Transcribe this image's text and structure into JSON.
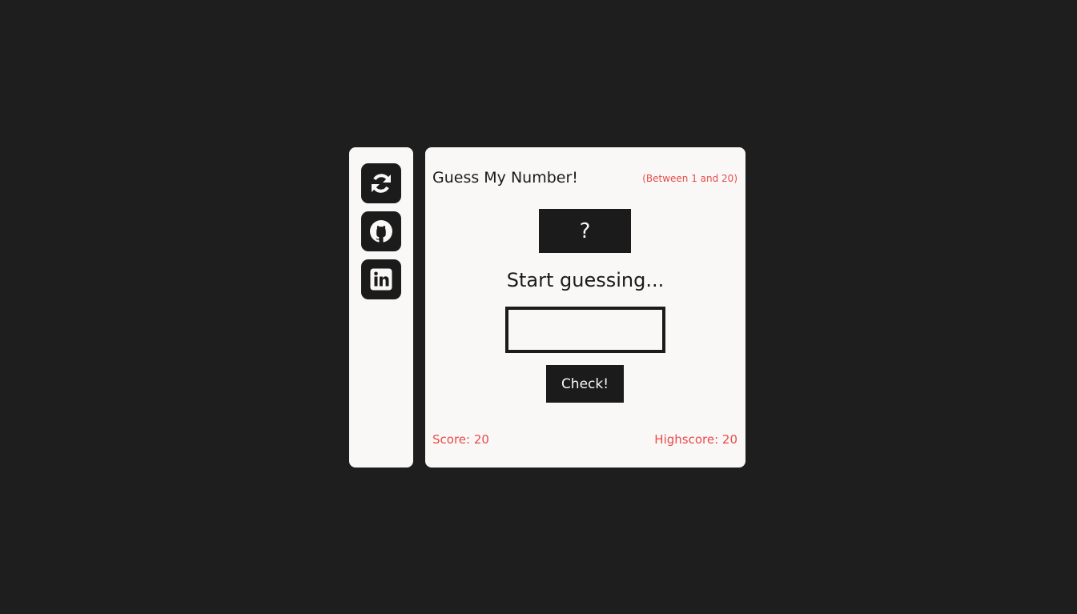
{
  "theme": {
    "background": "#1e1e1e",
    "card": "#f9f8f6",
    "dark": "#1b1b1b",
    "accent": "#e84b4b"
  },
  "sidebar": {
    "buttons": [
      {
        "icon": "refresh-icon"
      },
      {
        "icon": "github-icon"
      },
      {
        "icon": "linkedin-icon"
      }
    ]
  },
  "game": {
    "title": "Guess My Number!",
    "range_hint": "(Between 1 and 20)",
    "secret_number": "?",
    "message": "Start guessing...",
    "guess_value": "",
    "guess_placeholder": "",
    "check_label": "Check!",
    "score": "Score: 20",
    "highscore": "Highscore: 20"
  }
}
